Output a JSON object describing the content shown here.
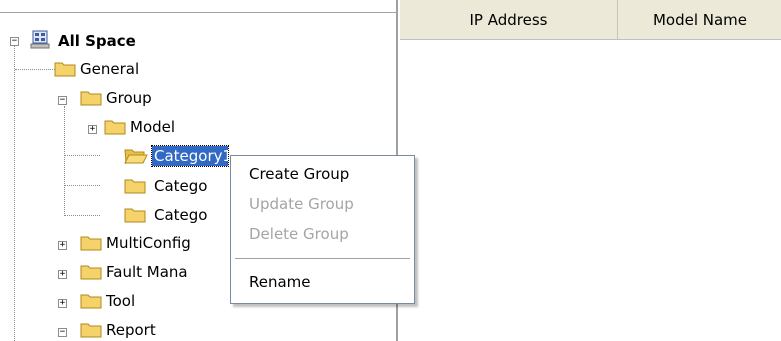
{
  "list": {
    "columns": [
      "IP Address",
      "Model Name"
    ]
  },
  "tree": {
    "root": "All Space",
    "items": [
      "General",
      "Group",
      "Model",
      "Category1",
      "Catego",
      "Catego",
      "MultiConfig",
      "Fault Mana",
      "Tool",
      "Report"
    ],
    "selected": "Category1"
  },
  "context_menu": {
    "items": [
      {
        "label": "Create Group",
        "enabled": true
      },
      {
        "label": "Update Group",
        "enabled": false
      },
      {
        "label": "Delete Group",
        "enabled": false
      },
      {
        "label": "Rename",
        "enabled": true
      }
    ]
  },
  "icons": {
    "root": "network-tree-icon",
    "folder": "folder-icon",
    "open_folder": "open-folder-icon",
    "expand": "plus-expander-icon",
    "collapse": "minus-expander-icon"
  },
  "colors": {
    "selection": "#316ac5",
    "header_bg": "#ece9d8",
    "folder": "#f5d36a",
    "disabled_text": "#a5a5a5"
  }
}
